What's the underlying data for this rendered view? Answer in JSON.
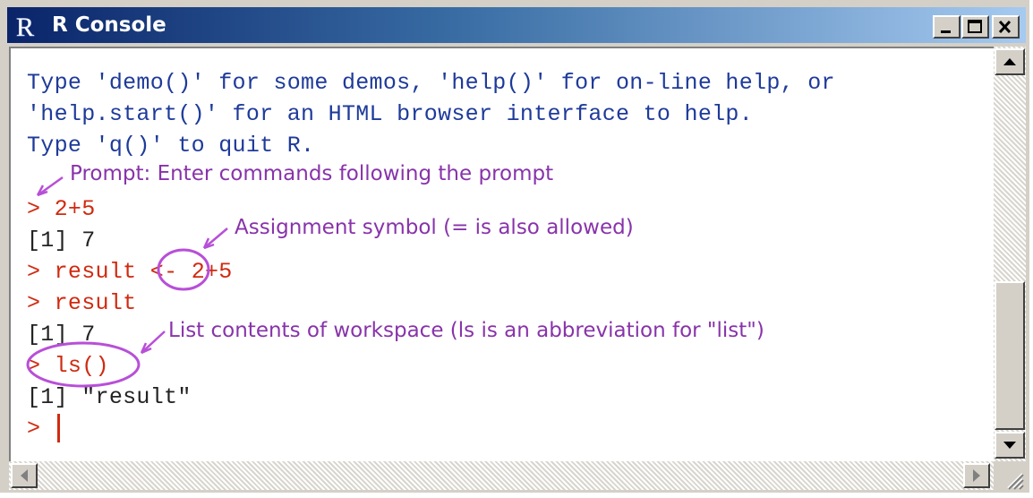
{
  "window": {
    "title": "R Console",
    "controls": {
      "minimize_icon": "minimize-icon",
      "maximize_icon": "maximize-icon",
      "close_icon": "close-icon"
    }
  },
  "console": {
    "intro": [
      "Type 'demo()' for some demos, 'help()' for on-line help, or",
      "'help.start()' for an HTML browser interface to help.",
      "Type 'q()' to quit R."
    ],
    "session": {
      "cmd1_prompt": ">",
      "cmd1": "2+5",
      "out1": "[1] 7",
      "cmd2_prompt": ">",
      "cmd2_name": "result",
      "cmd2_assign": "<-",
      "cmd2_expr": "2+5",
      "cmd3_prompt": ">",
      "cmd3": "result",
      "out3": "[1] 7",
      "cmd4_prompt": ">",
      "cmd4": "ls()",
      "out4": "[1] \"result\"",
      "final_prompt": ">"
    }
  },
  "annotations": {
    "prompt": "Prompt: Enter commands following the prompt",
    "assignment": "Assignment symbol (= is also allowed)",
    "ls": "List contents of workspace (ls is an abbreviation for \"list\")",
    "color": "#8833aa"
  },
  "colors": {
    "intro_text": "#1e3a9a",
    "input_text": "#d02a10",
    "output_text": "#222222",
    "titlebar_start": "#0a246a",
    "titlebar_end": "#a6caf0"
  }
}
